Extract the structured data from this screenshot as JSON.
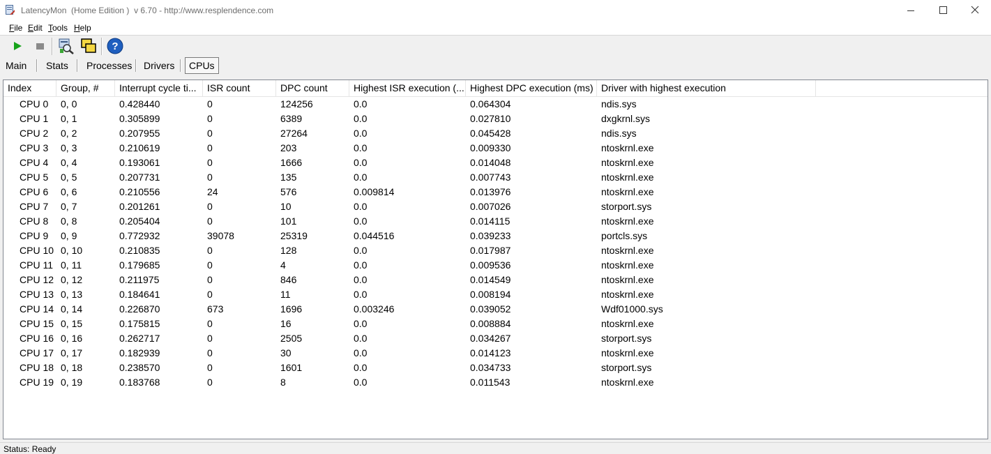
{
  "window": {
    "title": "LatencyMon  (Home Edition )  v 6.70 - http://www.resplendence.com"
  },
  "menu": [
    {
      "mnemonic": "F",
      "rest": "ile"
    },
    {
      "mnemonic": "E",
      "rest": "dit"
    },
    {
      "mnemonic": "T",
      "rest": "ools"
    },
    {
      "mnemonic": "H",
      "rest": "elp"
    }
  ],
  "toolbar": {
    "icons": [
      "play-icon",
      "stop-icon",
      "driver-search-icon",
      "windows-icon",
      "help-icon"
    ],
    "colors": {
      "play": "#17a31b",
      "stop": "#8a8a8a",
      "help": "#1f5fbf"
    }
  },
  "tabs": [
    {
      "label": "Main",
      "active": false
    },
    {
      "label": "Stats",
      "active": false
    },
    {
      "label": "Processes",
      "active": false
    },
    {
      "label": "Drivers",
      "active": false
    },
    {
      "label": "CPUs",
      "active": true
    }
  ],
  "table": {
    "columns": [
      "Index",
      "Group, #",
      "Interrupt cycle ti...",
      "ISR count",
      "DPC count",
      "Highest ISR execution (...",
      "Highest DPC execution (ms)",
      "Driver with highest execution"
    ],
    "rows": [
      [
        "CPU 0",
        "0, 0",
        "0.428440",
        "0",
        "124256",
        "0.0",
        "0.064304",
        "ndis.sys"
      ],
      [
        "CPU 1",
        "0, 1",
        "0.305899",
        "0",
        "6389",
        "0.0",
        "0.027810",
        "dxgkrnl.sys"
      ],
      [
        "CPU 2",
        "0, 2",
        "0.207955",
        "0",
        "27264",
        "0.0",
        "0.045428",
        "ndis.sys"
      ],
      [
        "CPU 3",
        "0, 3",
        "0.210619",
        "0",
        "203",
        "0.0",
        "0.009330",
        "ntoskrnl.exe"
      ],
      [
        "CPU 4",
        "0, 4",
        "0.193061",
        "0",
        "1666",
        "0.0",
        "0.014048",
        "ntoskrnl.exe"
      ],
      [
        "CPU 5",
        "0, 5",
        "0.207731",
        "0",
        "135",
        "0.0",
        "0.007743",
        "ntoskrnl.exe"
      ],
      [
        "CPU 6",
        "0, 6",
        "0.210556",
        "24",
        "576",
        "0.009814",
        "0.013976",
        "ntoskrnl.exe"
      ],
      [
        "CPU 7",
        "0, 7",
        "0.201261",
        "0",
        "10",
        "0.0",
        "0.007026",
        "storport.sys"
      ],
      [
        "CPU 8",
        "0, 8",
        "0.205404",
        "0",
        "101",
        "0.0",
        "0.014115",
        "ntoskrnl.exe"
      ],
      [
        "CPU 9",
        "0, 9",
        "0.772932",
        "39078",
        "25319",
        "0.044516",
        "0.039233",
        "portcls.sys"
      ],
      [
        "CPU 10",
        "0, 10",
        "0.210835",
        "0",
        "128",
        "0.0",
        "0.017987",
        "ntoskrnl.exe"
      ],
      [
        "CPU 11",
        "0, 11",
        "0.179685",
        "0",
        "4",
        "0.0",
        "0.009536",
        "ntoskrnl.exe"
      ],
      [
        "CPU 12",
        "0, 12",
        "0.211975",
        "0",
        "846",
        "0.0",
        "0.014549",
        "ntoskrnl.exe"
      ],
      [
        "CPU 13",
        "0, 13",
        "0.184641",
        "0",
        "11",
        "0.0",
        "0.008194",
        "ntoskrnl.exe"
      ],
      [
        "CPU 14",
        "0, 14",
        "0.226870",
        "673",
        "1696",
        "0.003246",
        "0.039052",
        "Wdf01000.sys"
      ],
      [
        "CPU 15",
        "0, 15",
        "0.175815",
        "0",
        "16",
        "0.0",
        "0.008884",
        "ntoskrnl.exe"
      ],
      [
        "CPU 16",
        "0, 16",
        "0.262717",
        "0",
        "2505",
        "0.0",
        "0.034267",
        "storport.sys"
      ],
      [
        "CPU 17",
        "0, 17",
        "0.182939",
        "0",
        "30",
        "0.0",
        "0.014123",
        "ntoskrnl.exe"
      ],
      [
        "CPU 18",
        "0, 18",
        "0.238570",
        "0",
        "1601",
        "0.0",
        "0.034733",
        "storport.sys"
      ],
      [
        "CPU 19",
        "0, 19",
        "0.183768",
        "0",
        "8",
        "0.0",
        "0.011543",
        "ntoskrnl.exe"
      ]
    ]
  },
  "status": {
    "text": "Status: Ready"
  }
}
